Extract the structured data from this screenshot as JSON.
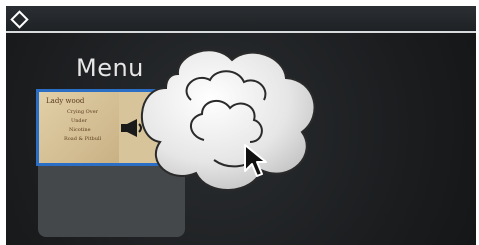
{
  "header": {
    "icon": "diamond-icon"
  },
  "menu": {
    "title": "Menu"
  },
  "thumbnail": {
    "title": "Lady wood",
    "lines": [
      "Crying Over",
      "Under",
      "Nicotine",
      "Road & Pitbull"
    ]
  },
  "icons": {
    "speaker": "speaker-icon",
    "cloud": "cloud-graphic",
    "cursor": "pointer-icon"
  },
  "colors": {
    "header_bg": "#24282b",
    "stage_bg": "#1f2123",
    "panel_bg": "#45484b",
    "thumb_border": "#2a6ec6"
  }
}
